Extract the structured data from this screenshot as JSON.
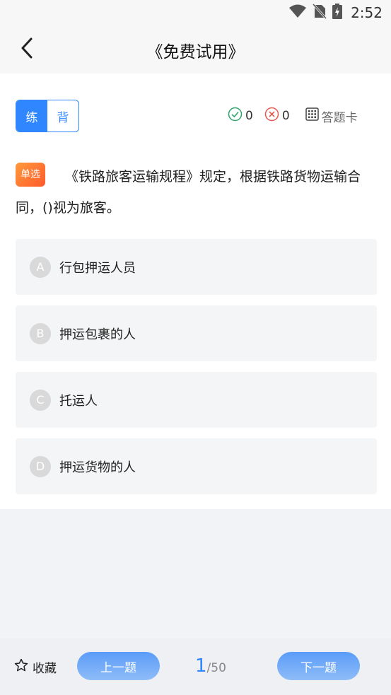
{
  "status_bar": {
    "time": "2:52",
    "icons": [
      "wifi-icon",
      "no-sim-icon",
      "battery-charging-icon"
    ]
  },
  "header": {
    "title": "《免费试用》",
    "back_icon": "chevron-left-icon"
  },
  "toolbar": {
    "mode_practice": "练",
    "mode_memorize": "背",
    "correct_count": "0",
    "wrong_count": "0",
    "answer_card_label": "答题卡"
  },
  "question": {
    "type_label": "单选",
    "text": "《铁路旅客运输规程》规定，根据铁路货物运输合同，()视为旅客。",
    "options": [
      {
        "letter": "A",
        "text": "行包押运人员"
      },
      {
        "letter": "B",
        "text": "押运包裹的人"
      },
      {
        "letter": "C",
        "text": "托运人"
      },
      {
        "letter": "D",
        "text": "押运货物的人"
      }
    ]
  },
  "footer": {
    "favorite_label": "收藏",
    "prev_label": "上一题",
    "next_label": "下一题",
    "current_page": "1",
    "total_pages": "/50"
  },
  "colors": {
    "accent": "#2f86ff",
    "badge_start": "#ff9a3c",
    "badge_end": "#ff5a2c",
    "correct": "#2fa36b",
    "wrong": "#e8584e"
  }
}
